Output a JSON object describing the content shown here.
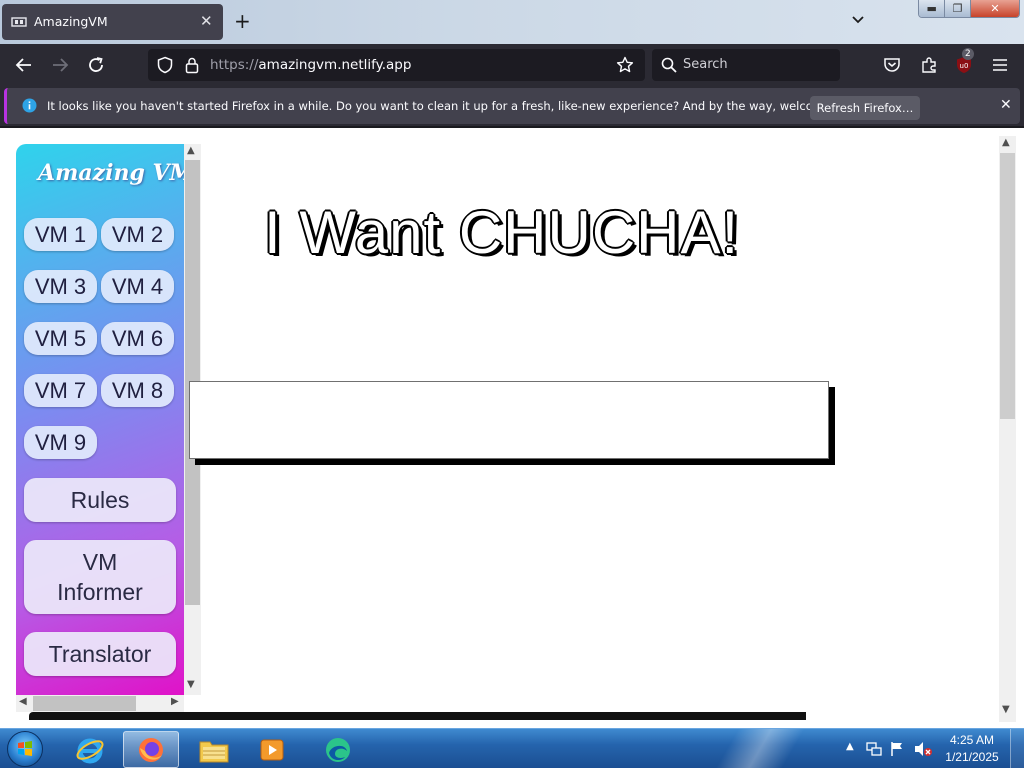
{
  "browser": {
    "tab": {
      "title": "AmazingVM",
      "close_glyph": "✕"
    },
    "new_tab_glyph": "+",
    "url": {
      "protocol": "https://",
      "host": "amazingvm.netlify.app"
    },
    "search_placeholder": "Search",
    "extension_badge": "2",
    "window_controls": {
      "minimize": "▬",
      "maximize": "❐",
      "close": "✕"
    }
  },
  "notification": {
    "message": "It looks like you haven't started Firefox in a while. Do you want to clean it up for a fresh, like-new experience? And by the way, welcome back!",
    "button": "Refresh Firefox…",
    "close_glyph": "✕"
  },
  "site": {
    "logo": "Amazing VM",
    "vm_buttons": [
      "VM 1",
      "VM 2",
      "VM 3",
      "VM 4",
      "VM 5",
      "VM 6",
      "VM 7",
      "VM 8",
      "VM 9"
    ],
    "rules_button": "Rules",
    "informer_button_line1": "VM",
    "informer_button_line2": "Informer",
    "translator_button": "Translator",
    "headline": "I Want CHUCHA!"
  },
  "taskbar": {
    "time": "4:25 AM",
    "date": "1/21/2025",
    "apps": [
      "internet-explorer",
      "firefox",
      "file-explorer",
      "media-player",
      "edge"
    ]
  },
  "colors": {
    "accent_notification": "#b833e1",
    "sidebar_gradient_start": "#2fd3ec",
    "sidebar_gradient_end": "#e012c8"
  }
}
